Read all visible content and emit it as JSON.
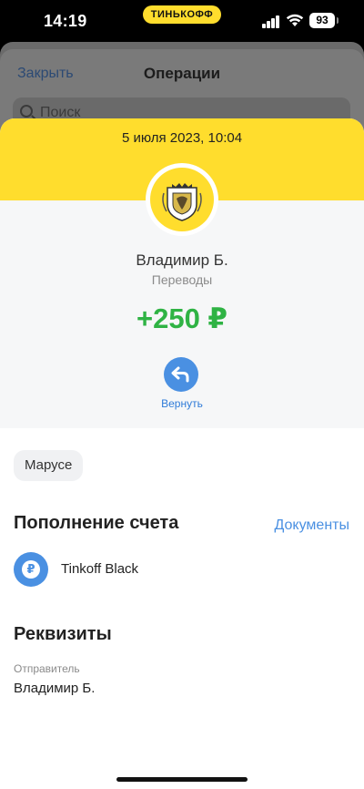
{
  "status_bar": {
    "time": "14:19",
    "carrier_pill": "ТИНЬКОФФ",
    "battery": "93"
  },
  "background_screen": {
    "close_label": "Закрыть",
    "title": "Операции",
    "search_placeholder": "Поиск"
  },
  "operation": {
    "date": "5 июля 2023, 10:04",
    "counterparty": "Владимир Б.",
    "category": "Переводы",
    "amount": "+250 ₽",
    "return_label": "Вернуть",
    "comment_tag": "Марусе"
  },
  "topup": {
    "title": "Пополнение счета",
    "documents_label": "Документы",
    "account_name": "Tinkoff Black",
    "account_symbol": "₽"
  },
  "details": {
    "title": "Реквизиты",
    "sender_label": "Отправитель",
    "sender_value": "Владимир Б."
  },
  "colors": {
    "brand_yellow": "#ffdd2d",
    "amount_green": "#2fb344",
    "accent_blue": "#4a90e2"
  }
}
